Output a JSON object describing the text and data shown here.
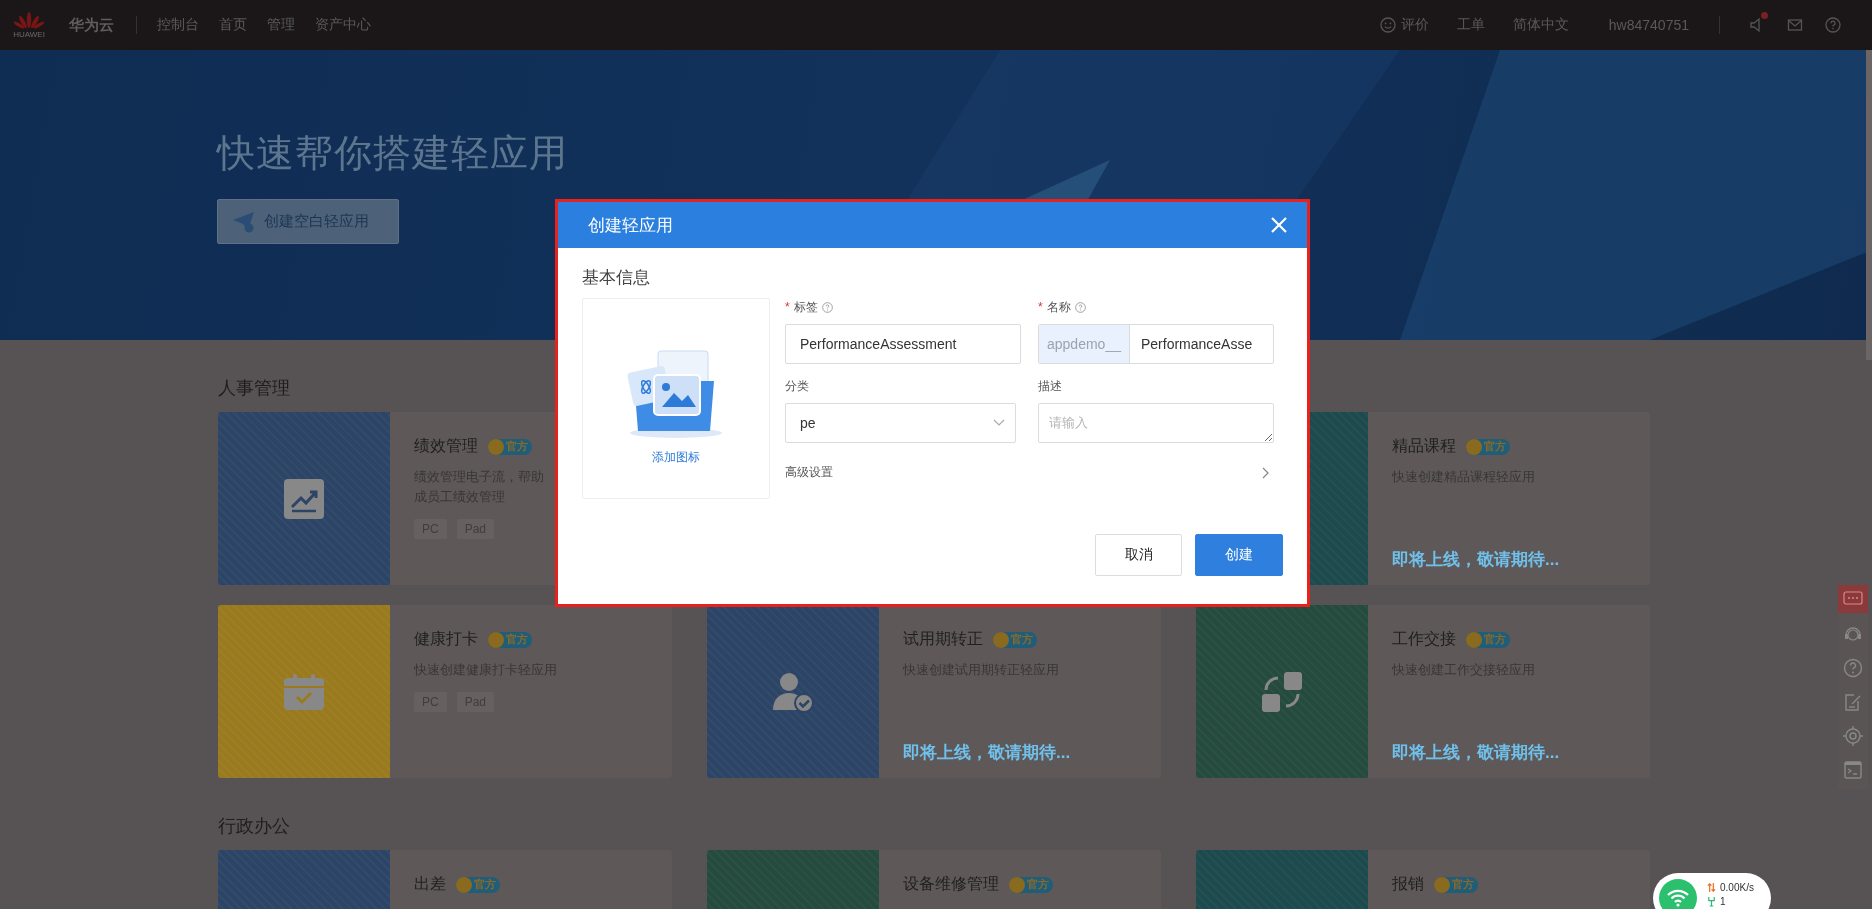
{
  "top_bar": {
    "logo_text": "HUAWEI",
    "brand": "华为云",
    "nav": [
      "控制台",
      "首页",
      "管理",
      "资产中心"
    ],
    "links": [
      {
        "label": "评价",
        "kind": "feedback"
      },
      {
        "label": "工单",
        "kind": "plain"
      },
      {
        "label": "简体中文",
        "kind": "plain"
      },
      {
        "label": "hw84740751",
        "kind": "plain"
      }
    ],
    "notification_dot": true
  },
  "banner": {
    "title": "快速帮你搭建轻应用",
    "button": "创建空白轻应用"
  },
  "sections": [
    {
      "title": "人事管理",
      "cards": [
        {
          "title": "绩效管理",
          "badge": "官方",
          "description": [
            "绩效管理电子流，帮助",
            "成员工绩效管理"
          ],
          "tags": [
            "PC",
            "Pad"
          ],
          "color": "#2c4466",
          "kind": "chart"
        },
        {
          "title": "精品课程",
          "badge": "官方",
          "description": [
            "快速创建精品课程轻应用"
          ],
          "status": "即将上线，敬请期待...",
          "color": "#1d4a4d",
          "kind": "plain"
        },
        {
          "title": "健康打卡",
          "badge": "官方",
          "description": [
            "快速创建健康打卡轻应用"
          ],
          "tags": [
            "PC",
            "Pad"
          ],
          "color": "#9a7a1e",
          "kind": "calendar"
        },
        {
          "title": "试用期转正",
          "badge": "官方",
          "description": [
            "快速创建试用期转正轻应用"
          ],
          "status": "即将上线，敬请期待...",
          "color": "#2c4466",
          "kind": "person"
        },
        {
          "title": "工作交接",
          "badge": "官方",
          "description": [
            "快速创建工作交接轻应用"
          ],
          "status": "即将上线，敬请期待...",
          "color": "#254a3e",
          "kind": "swap"
        }
      ]
    },
    {
      "title": "行政办公",
      "cards": [
        {
          "title": "出差",
          "badge": "官方",
          "color": "#2c4466",
          "kind": "plain"
        },
        {
          "title": "设备维修管理",
          "badge": "官方",
          "color": "#254a3e",
          "kind": "plain"
        },
        {
          "title": "报销",
          "badge": "官方",
          "color": "#1d4a4d",
          "kind": "plain"
        }
      ]
    }
  ],
  "dialog": {
    "title": "创建轻应用",
    "section": "基本信息",
    "upload_label": "添加图标",
    "fields": [
      {
        "label": "标签",
        "required_mark": "*",
        "kind": "input",
        "value": "PerformanceAssessment"
      },
      {
        "label": "名称",
        "required_mark": "*",
        "kind": "prefixed",
        "prefix": "appdemo__",
        "value": "PerformanceAsse"
      },
      {
        "label": "分类",
        "kind": "select",
        "value": "pe"
      },
      {
        "label": "描述",
        "kind": "textarea",
        "placeholder": "请输入"
      }
    ],
    "advanced": "高级设置",
    "buttons": [
      {
        "label": "取消",
        "kind": "secondary"
      },
      {
        "label": "创建",
        "kind": "primary"
      }
    ]
  },
  "network_widget": {
    "speed": "0.00K/s",
    "count": "1"
  }
}
